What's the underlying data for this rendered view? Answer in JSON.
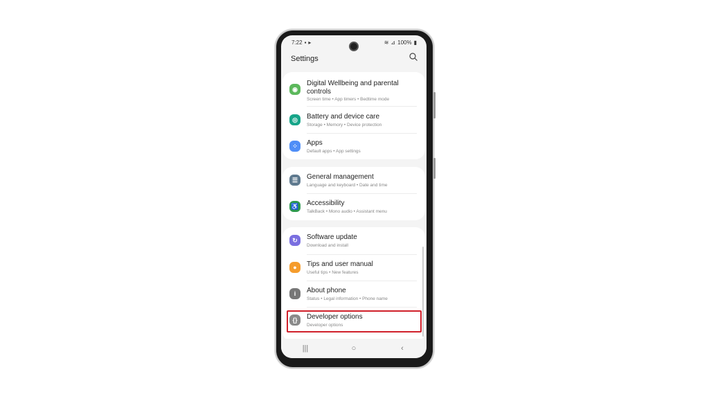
{
  "status": {
    "time": "7:22",
    "battery": "100%",
    "icons": [
      "notification-icon",
      "video-icon",
      "wifi-icon",
      "signal-icon",
      "battery-icon"
    ]
  },
  "header": {
    "title": "Settings"
  },
  "items": [
    {
      "label": "Digital Wellbeing and parental",
      "label2": "controls",
      "sub": "Screen time  •  App timers  •  Bedtime mode",
      "color": "#5cb85c",
      "icon": "digital-wellbeing-icon"
    },
    {
      "label": "Battery and device care",
      "sub": "Storage  •  Memory  •  Device protection",
      "color": "#17a589",
      "icon": "device-care-icon"
    },
    {
      "label": "Apps",
      "sub": "Default apps  •  App settings",
      "color": "#4f8ef7",
      "icon": "apps-icon"
    },
    {
      "label": "General management",
      "sub": "Language and keyboard  •  Date and time",
      "color": "#5f7a8f",
      "icon": "general-management-icon"
    },
    {
      "label": "Accessibility",
      "sub": "TalkBack  •  Mono audio  •  Assistant menu",
      "color": "#2e9a4e",
      "icon": "accessibility-icon"
    },
    {
      "label": "Software update",
      "sub": "Download and install",
      "color": "#7a6fe0",
      "icon": "software-update-icon"
    },
    {
      "label": "Tips and user manual",
      "sub": "Useful tips  •  New features",
      "color": "#f59c2c",
      "icon": "tips-icon"
    },
    {
      "label": "About phone",
      "sub": "Status  •  Legal information  •  Phone name",
      "color": "#777777",
      "icon": "about-phone-icon"
    },
    {
      "label": "Developer options",
      "sub": "Developer options",
      "color": "#8a8a8a",
      "icon": "developer-options-icon"
    }
  ],
  "highlight_color": "#d0202a",
  "nav": {
    "recents": "|||",
    "home": "○",
    "back": "‹"
  }
}
